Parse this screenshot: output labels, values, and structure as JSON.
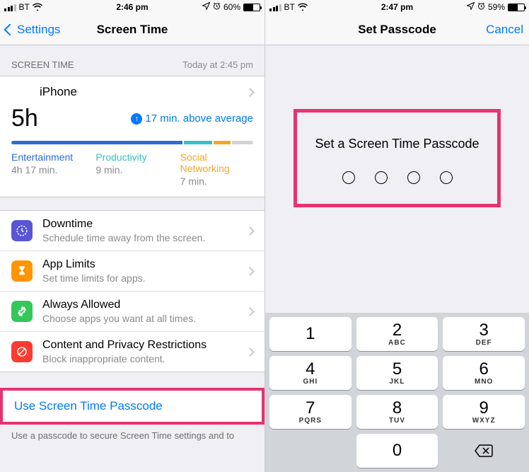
{
  "left": {
    "status": {
      "carrier": "BT",
      "time": "2:46 pm",
      "battery_pct": "60%"
    },
    "nav": {
      "back": "Settings",
      "title": "Screen Time"
    },
    "section_header": {
      "label": "SCREEN TIME",
      "right": "Today at 2:45 pm"
    },
    "device": "iPhone",
    "total": "5h",
    "above_avg": "17 min. above average",
    "categories": [
      {
        "name": "Entertainment",
        "val": "4h 17 min."
      },
      {
        "name": "Productivity",
        "val": "9 min."
      },
      {
        "name": "Social Networking",
        "val": "7 min."
      }
    ],
    "items": [
      {
        "title": "Downtime",
        "sub": "Schedule time away from the screen."
      },
      {
        "title": "App Limits",
        "sub": "Set time limits for apps."
      },
      {
        "title": "Always Allowed",
        "sub": "Choose apps you want at all times."
      },
      {
        "title": "Content and Privacy Restrictions",
        "sub": "Block inappropriate content."
      }
    ],
    "passcode_link": "Use Screen Time Passcode",
    "footer": "Use a passcode to secure Screen Time settings and to"
  },
  "right": {
    "status": {
      "carrier": "BT",
      "time": "2:47 pm",
      "battery_pct": "59%"
    },
    "nav": {
      "title": "Set Passcode",
      "cancel": "Cancel"
    },
    "prompt": "Set a Screen Time Passcode",
    "keypad": [
      {
        "num": "1",
        "letters": ""
      },
      {
        "num": "2",
        "letters": "ABC"
      },
      {
        "num": "3",
        "letters": "DEF"
      },
      {
        "num": "4",
        "letters": "GHI"
      },
      {
        "num": "5",
        "letters": "JKL"
      },
      {
        "num": "6",
        "letters": "MNO"
      },
      {
        "num": "7",
        "letters": "PQRS"
      },
      {
        "num": "8",
        "letters": "TUV"
      },
      {
        "num": "9",
        "letters": "WXYZ"
      },
      {
        "num": "0",
        "letters": ""
      }
    ]
  }
}
